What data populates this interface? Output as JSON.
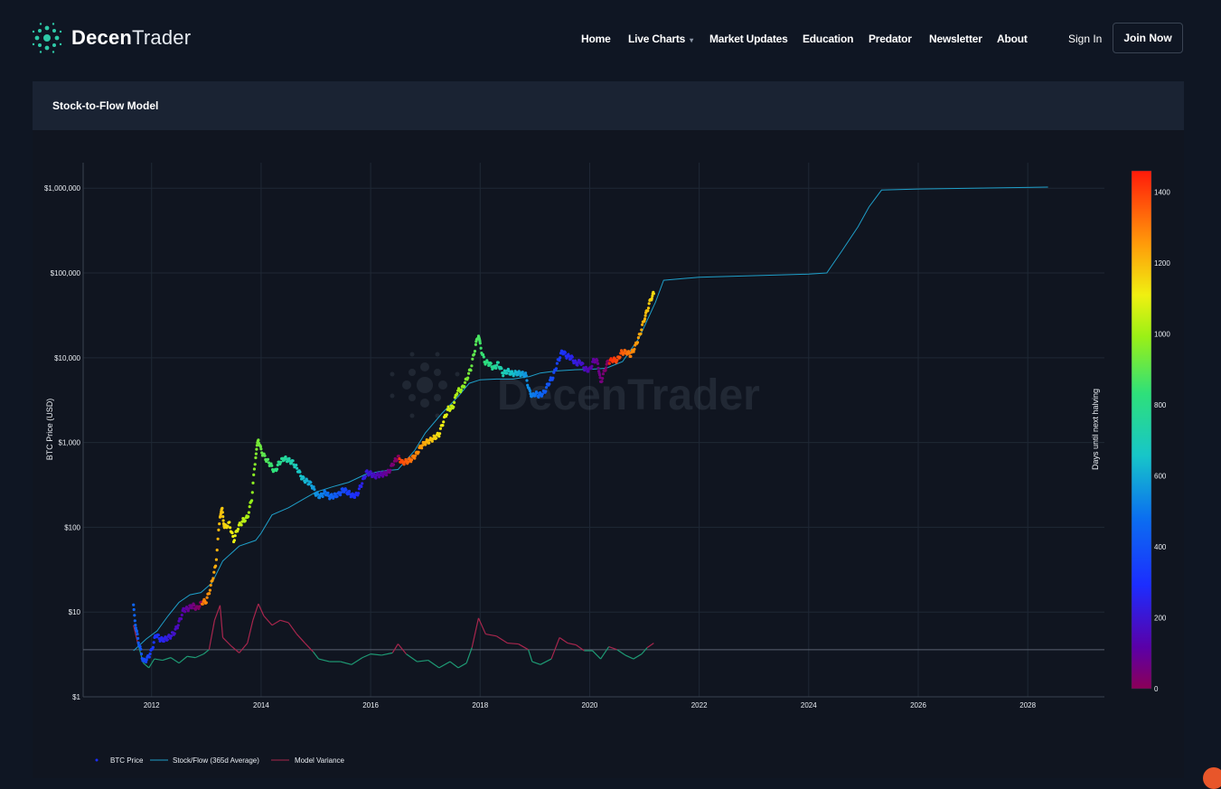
{
  "brand": {
    "part1": "Decen",
    "part2": "Trader"
  },
  "nav": {
    "items": [
      {
        "label": "Home"
      },
      {
        "label": "Live Charts",
        "has_dropdown": true
      },
      {
        "label": "Market Updates"
      },
      {
        "label": "Education"
      },
      {
        "label": "Predator"
      },
      {
        "label": "Newsletter"
      },
      {
        "label": "About"
      }
    ],
    "sign_in": "Sign In",
    "join": "Join Now"
  },
  "panel": {
    "title": "Stock-to-Flow Model"
  },
  "colors": {
    "background": "#0f1623",
    "panel_header": "#1a2333",
    "plot_background": "#101520",
    "stock_flow_line": "#1f9fc9",
    "variance_above": "#a8264d",
    "variance_below": "#1e9a74",
    "accent_logo": "#2ec9a7"
  },
  "chart_data": {
    "type": "scatter",
    "ylabel": "BTC Price (USD)",
    "y_scale": "log",
    "ylim": [
      1,
      2000000
    ],
    "y_ticks": [
      {
        "value": 1,
        "label": "$1"
      },
      {
        "value": 10,
        "label": "$10"
      },
      {
        "value": 100,
        "label": "$100"
      },
      {
        "value": 1000,
        "label": "$1,000"
      },
      {
        "value": 10000,
        "label": "$10,000"
      },
      {
        "value": 100000,
        "label": "$100,000"
      },
      {
        "value": 1000000,
        "label": "$1,000,000"
      }
    ],
    "xlim": [
      2010.75,
      2029.4
    ],
    "x_ticks": [
      "2012",
      "2014",
      "2016",
      "2018",
      "2020",
      "2022",
      "2024",
      "2026",
      "2028"
    ],
    "colorbar": {
      "title": "Days until next halving",
      "range": [
        0,
        1460
      ],
      "ticks": [
        0,
        200,
        400,
        600,
        800,
        1000,
        1200,
        1400
      ]
    },
    "watermark": "DecenTrader",
    "legend_position": "bottom-left",
    "series": [
      {
        "name": "BTC Price",
        "marker": "points colored by days until next halving",
        "points": [
          [
            2011.67,
            11.5
          ],
          [
            2011.72,
            6
          ],
          [
            2011.78,
            4
          ],
          [
            2011.85,
            2.6
          ],
          [
            2011.92,
            2.8
          ],
          [
            2012.0,
            3.5
          ],
          [
            2012.08,
            5.5
          ],
          [
            2012.17,
            4.7
          ],
          [
            2012.25,
            4.8
          ],
          [
            2012.33,
            5.1
          ],
          [
            2012.42,
            5.8
          ],
          [
            2012.5,
            7.5
          ],
          [
            2012.58,
            10.5
          ],
          [
            2012.67,
            11
          ],
          [
            2012.75,
            12
          ],
          [
            2012.83,
            11
          ],
          [
            2012.92,
            13
          ],
          [
            2013.0,
            13.5
          ],
          [
            2013.08,
            20
          ],
          [
            2013.17,
            35
          ],
          [
            2013.25,
            140
          ],
          [
            2013.29,
            160
          ],
          [
            2013.33,
            100
          ],
          [
            2013.42,
            110
          ],
          [
            2013.5,
            70
          ],
          [
            2013.58,
            100
          ],
          [
            2013.67,
            120
          ],
          [
            2013.75,
            130
          ],
          [
            2013.83,
            220
          ],
          [
            2013.9,
            700
          ],
          [
            2013.95,
            1100
          ],
          [
            2014.0,
            800
          ],
          [
            2014.08,
            650
          ],
          [
            2014.17,
            550
          ],
          [
            2014.25,
            450
          ],
          [
            2014.33,
            580
          ],
          [
            2014.42,
            650
          ],
          [
            2014.5,
            620
          ],
          [
            2014.58,
            580
          ],
          [
            2014.67,
            480
          ],
          [
            2014.75,
            380
          ],
          [
            2014.83,
            350
          ],
          [
            2014.92,
            320
          ],
          [
            2015.0,
            250
          ],
          [
            2015.08,
            230
          ],
          [
            2015.17,
            260
          ],
          [
            2015.25,
            230
          ],
          [
            2015.33,
            235
          ],
          [
            2015.42,
            245
          ],
          [
            2015.5,
            280
          ],
          [
            2015.58,
            260
          ],
          [
            2015.67,
            235
          ],
          [
            2015.75,
            240
          ],
          [
            2015.83,
            320
          ],
          [
            2015.92,
            440
          ],
          [
            2016.0,
            430
          ],
          [
            2016.08,
            400
          ],
          [
            2016.17,
            420
          ],
          [
            2016.25,
            425
          ],
          [
            2016.33,
            450
          ],
          [
            2016.42,
            580
          ],
          [
            2016.5,
            670
          ],
          [
            2016.58,
            580
          ],
          [
            2016.67,
            600
          ],
          [
            2016.75,
            640
          ],
          [
            2016.83,
            720
          ],
          [
            2016.92,
            900
          ],
          [
            2017.0,
            1000
          ],
          [
            2017.08,
            1050
          ],
          [
            2017.17,
            1150
          ],
          [
            2017.25,
            1250
          ],
          [
            2017.33,
            1800
          ],
          [
            2017.42,
            2500
          ],
          [
            2017.5,
            2600
          ],
          [
            2017.58,
            4000
          ],
          [
            2017.67,
            4300
          ],
          [
            2017.75,
            5500
          ],
          [
            2017.83,
            7500
          ],
          [
            2017.92,
            14000
          ],
          [
            2017.97,
            19000
          ],
          [
            2018.0,
            14000
          ],
          [
            2018.08,
            9000
          ],
          [
            2018.17,
            8500
          ],
          [
            2018.25,
            7500
          ],
          [
            2018.33,
            8500
          ],
          [
            2018.42,
            6500
          ],
          [
            2018.5,
            7000
          ],
          [
            2018.58,
            6500
          ],
          [
            2018.67,
            6600
          ],
          [
            2018.75,
            6500
          ],
          [
            2018.83,
            6300
          ],
          [
            2018.9,
            4000
          ],
          [
            2018.96,
            3500
          ],
          [
            2019.0,
            3800
          ],
          [
            2019.08,
            3600
          ],
          [
            2019.17,
            3900
          ],
          [
            2019.25,
            5000
          ],
          [
            2019.33,
            6000
          ],
          [
            2019.42,
            9000
          ],
          [
            2019.5,
            12000
          ],
          [
            2019.58,
            10500
          ],
          [
            2019.67,
            10000
          ],
          [
            2019.75,
            8500
          ],
          [
            2019.83,
            9000
          ],
          [
            2019.92,
            7300
          ],
          [
            2020.0,
            7200
          ],
          [
            2020.08,
            9500
          ],
          [
            2020.15,
            8800
          ],
          [
            2020.2,
            5000
          ],
          [
            2020.27,
            7000
          ],
          [
            2020.33,
            8800
          ],
          [
            2020.42,
            9500
          ],
          [
            2020.5,
            9300
          ],
          [
            2020.58,
            11500
          ],
          [
            2020.67,
            11700
          ],
          [
            2020.75,
            10800
          ],
          [
            2020.83,
            13500
          ],
          [
            2020.92,
            19000
          ],
          [
            2021.0,
            29000
          ],
          [
            2021.05,
            36000
          ],
          [
            2021.12,
            50000
          ],
          [
            2021.17,
            57000
          ]
        ]
      },
      {
        "name": "Stock/Flow (365d Average)",
        "points": [
          [
            2011.67,
            3.5
          ],
          [
            2011.9,
            4.8
          ],
          [
            2012.1,
            6
          ],
          [
            2012.3,
            9
          ],
          [
            2012.5,
            13
          ],
          [
            2012.7,
            16
          ],
          [
            2012.9,
            17
          ],
          [
            2013.1,
            22
          ],
          [
            2013.3,
            40
          ],
          [
            2013.6,
            60
          ],
          [
            2013.9,
            70
          ],
          [
            2014.0,
            85
          ],
          [
            2014.2,
            140
          ],
          [
            2014.5,
            170
          ],
          [
            2014.8,
            220
          ],
          [
            2015.0,
            260
          ],
          [
            2015.3,
            300
          ],
          [
            2015.6,
            340
          ],
          [
            2015.9,
            420
          ],
          [
            2016.2,
            460
          ],
          [
            2016.5,
            480
          ],
          [
            2016.8,
            800
          ],
          [
            2017.0,
            1300
          ],
          [
            2017.3,
            2200
          ],
          [
            2017.6,
            3500
          ],
          [
            2017.8,
            5000
          ],
          [
            2018.0,
            5500
          ],
          [
            2018.3,
            5600
          ],
          [
            2018.6,
            5600
          ],
          [
            2018.9,
            6000
          ],
          [
            2019.1,
            6600
          ],
          [
            2019.4,
            7000
          ],
          [
            2019.7,
            7200
          ],
          [
            2020.0,
            7300
          ],
          [
            2020.3,
            7500
          ],
          [
            2020.6,
            9000
          ],
          [
            2020.9,
            17000
          ],
          [
            2021.2,
            45000
          ],
          [
            2021.35,
            82000
          ],
          [
            2021.7,
            86000
          ],
          [
            2022.0,
            89000
          ],
          [
            2022.5,
            91000
          ],
          [
            2023.0,
            93000
          ],
          [
            2023.5,
            95000
          ],
          [
            2024.0,
            97000
          ],
          [
            2024.33,
            100000
          ],
          [
            2024.6,
            180000
          ],
          [
            2024.9,
            350000
          ],
          [
            2025.1,
            600000
          ],
          [
            2025.33,
            950000
          ],
          [
            2026.0,
            980000
          ],
          [
            2027.0,
            1000000
          ],
          [
            2028.37,
            1030000
          ]
        ]
      },
      {
        "name": "Model Variance",
        "baseline": 3.6,
        "points": [
          [
            2011.67,
            7
          ],
          [
            2011.75,
            4.2
          ],
          [
            2011.85,
            2.5
          ],
          [
            2011.95,
            2.2
          ],
          [
            2012.05,
            2.8
          ],
          [
            2012.2,
            2.7
          ],
          [
            2012.35,
            2.9
          ],
          [
            2012.5,
            2.5
          ],
          [
            2012.65,
            3
          ],
          [
            2012.8,
            2.9
          ],
          [
            2012.95,
            3.2
          ],
          [
            2013.05,
            3.6
          ],
          [
            2013.15,
            8
          ],
          [
            2013.25,
            12
          ],
          [
            2013.3,
            5
          ],
          [
            2013.45,
            4
          ],
          [
            2013.6,
            3.3
          ],
          [
            2013.75,
            4.3
          ],
          [
            2013.85,
            8
          ],
          [
            2013.95,
            12.5
          ],
          [
            2014.05,
            9
          ],
          [
            2014.2,
            7
          ],
          [
            2014.35,
            8
          ],
          [
            2014.5,
            7.5
          ],
          [
            2014.65,
            5.5
          ],
          [
            2014.8,
            4.3
          ],
          [
            2014.95,
            3.4
          ],
          [
            2015.05,
            2.8
          ],
          [
            2015.25,
            2.6
          ],
          [
            2015.45,
            2.6
          ],
          [
            2015.65,
            2.4
          ],
          [
            2015.85,
            2.9
          ],
          [
            2016.0,
            3.2
          ],
          [
            2016.2,
            3.1
          ],
          [
            2016.4,
            3.3
          ],
          [
            2016.5,
            4.2
          ],
          [
            2016.65,
            3.2
          ],
          [
            2016.85,
            2.6
          ],
          [
            2017.05,
            2.7
          ],
          [
            2017.25,
            2.2
          ],
          [
            2017.45,
            2.6
          ],
          [
            2017.6,
            2.2
          ],
          [
            2017.75,
            2.5
          ],
          [
            2017.85,
            3.8
          ],
          [
            2017.97,
            8.5
          ],
          [
            2018.1,
            5.5
          ],
          [
            2018.3,
            5.2
          ],
          [
            2018.5,
            4.3
          ],
          [
            2018.7,
            4.2
          ],
          [
            2018.88,
            3.6
          ],
          [
            2018.95,
            2.6
          ],
          [
            2019.1,
            2.4
          ],
          [
            2019.3,
            2.8
          ],
          [
            2019.45,
            5
          ],
          [
            2019.6,
            4.3
          ],
          [
            2019.75,
            4.1
          ],
          [
            2019.9,
            3.5
          ],
          [
            2020.05,
            3.5
          ],
          [
            2020.2,
            2.8
          ],
          [
            2020.35,
            3.9
          ],
          [
            2020.5,
            3.6
          ],
          [
            2020.65,
            3.1
          ],
          [
            2020.8,
            2.8
          ],
          [
            2020.95,
            3.2
          ],
          [
            2021.05,
            3.8
          ],
          [
            2021.17,
            4.3
          ]
        ]
      }
    ]
  }
}
